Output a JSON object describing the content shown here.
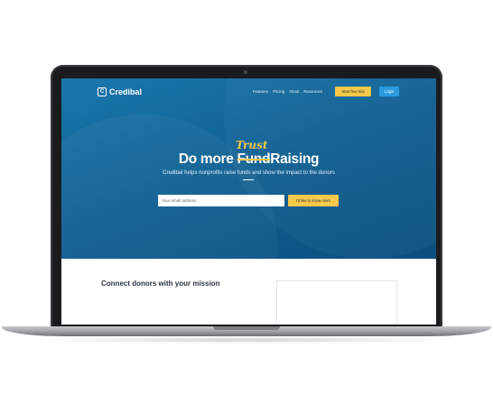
{
  "brand": {
    "name": "Credibal",
    "mark": "C"
  },
  "nav": [
    {
      "label": "Features"
    },
    {
      "label": "Pricing"
    },
    {
      "label": "About"
    },
    {
      "label": "Resources"
    }
  ],
  "header": {
    "trial_label": "Start free trial",
    "login_label": "Login"
  },
  "hero": {
    "headline_prefix": "Do more ",
    "headline_struck": "Fund",
    "headline_suffix": "Raising",
    "headline_overlay": "Trust",
    "subtitle": "Credibal helps nonprofits raise funds and show the impact to the donors",
    "email_placeholder": "Your email address",
    "cta_label": "I'd like to know more"
  },
  "section": {
    "heading": "Connect donors with your mission"
  },
  "colors": {
    "accent": "#f6c94a",
    "primary": "#0f5f92",
    "login": "#2b9be0"
  }
}
